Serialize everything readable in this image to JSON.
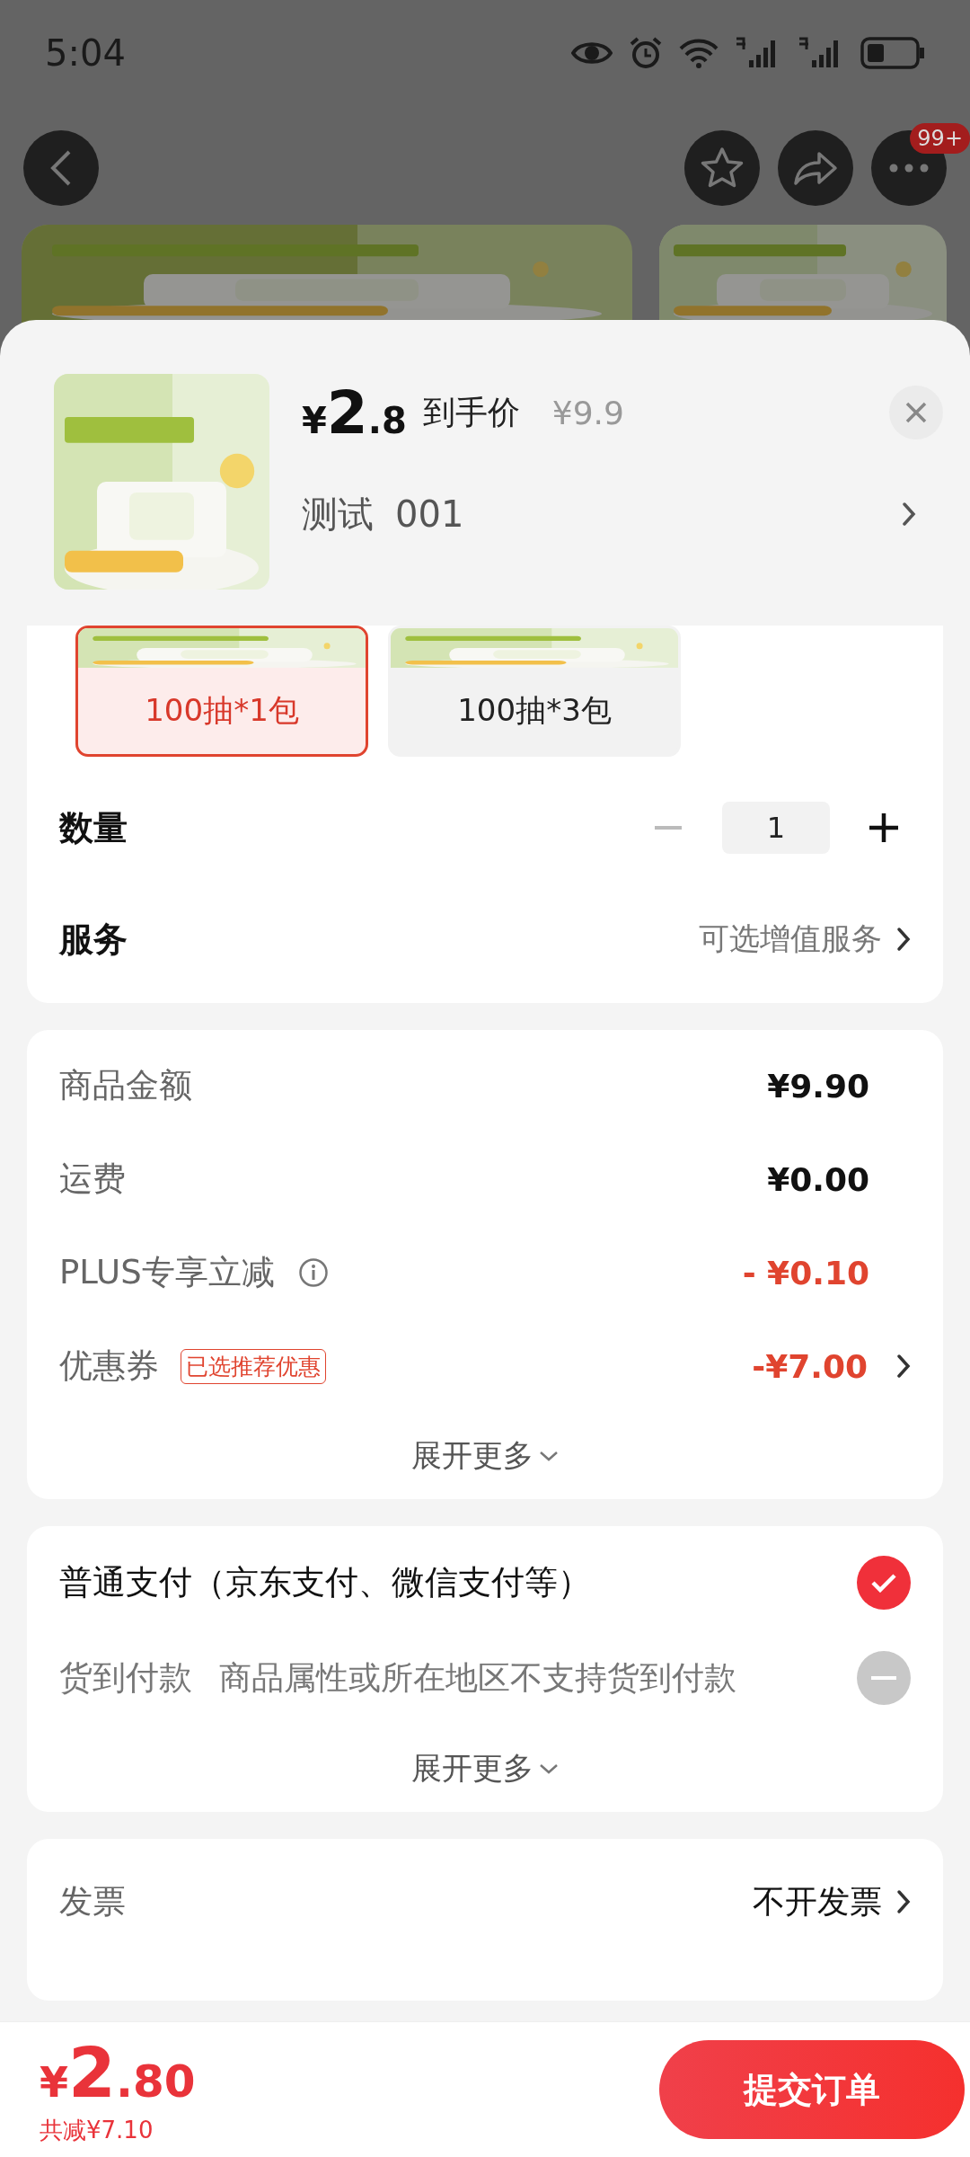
{
  "status_bar": {
    "time": "5:04"
  },
  "nav": {
    "badge": "99+"
  },
  "header": {
    "currency": "¥",
    "price_int": "2",
    "price_dec": ".8",
    "price_label": "到手价",
    "original_price": "¥9.9",
    "spec_name": "测试",
    "spec_value": "001"
  },
  "variants": [
    {
      "label": "100抽*1包",
      "selected": true
    },
    {
      "label": "100抽*3包",
      "selected": false
    }
  ],
  "quantity": {
    "label": "数量",
    "value": "1",
    "minus_disabled": true
  },
  "service": {
    "label": "服务",
    "value": "可选增值服务"
  },
  "costs": {
    "rows": [
      {
        "kind": "plain",
        "label": "商品金额",
        "value": "¥9.90"
      },
      {
        "kind": "plain",
        "label": "运费",
        "value": "¥0.00"
      },
      {
        "kind": "discount",
        "label": "PLUS专享立减",
        "value": "- ¥0.10",
        "info": true
      },
      {
        "kind": "discount",
        "label": "优惠券",
        "value": "-¥7.00",
        "tag": "已选推荐优惠",
        "chevron": true
      }
    ],
    "expand": "展开更多"
  },
  "payment": {
    "options": [
      {
        "label": "普通支付（京东支付、微信支付等）",
        "selected": true,
        "disabled": false
      },
      {
        "label": "货到付款",
        "note": "商品属性或所在地区不支持货到付款",
        "selected": false,
        "disabled": true
      }
    ],
    "expand": "展开更多"
  },
  "invoice": {
    "label": "发票",
    "value": "不开发票"
  },
  "bottom_bar": {
    "currency": "¥",
    "total_int": "2",
    "total_dec": ".80",
    "savings": "共减¥7.10",
    "submit": "提交订单"
  }
}
